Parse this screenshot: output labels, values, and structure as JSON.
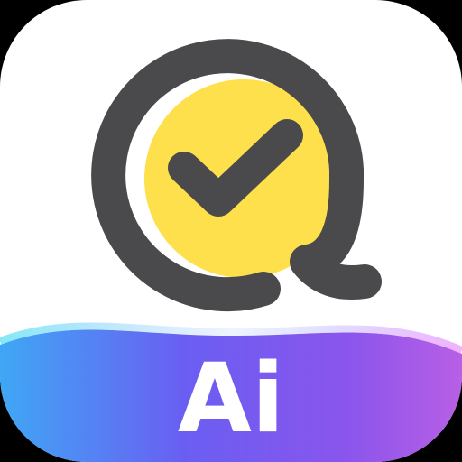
{
  "icon": {
    "label": "Ai",
    "symbol": "check-mark-icon",
    "colors": {
      "background": "#ffffff",
      "ring": "#4a4a4c",
      "circle_fill": "#fde04c",
      "check": "#4a4a4c",
      "wave_gradient": [
        "#3fa7f5",
        "#6a5ef2",
        "#8a55ec",
        "#b85fe6"
      ],
      "wave_highlight": "#7fe7f5",
      "text": "#ffffff"
    }
  }
}
